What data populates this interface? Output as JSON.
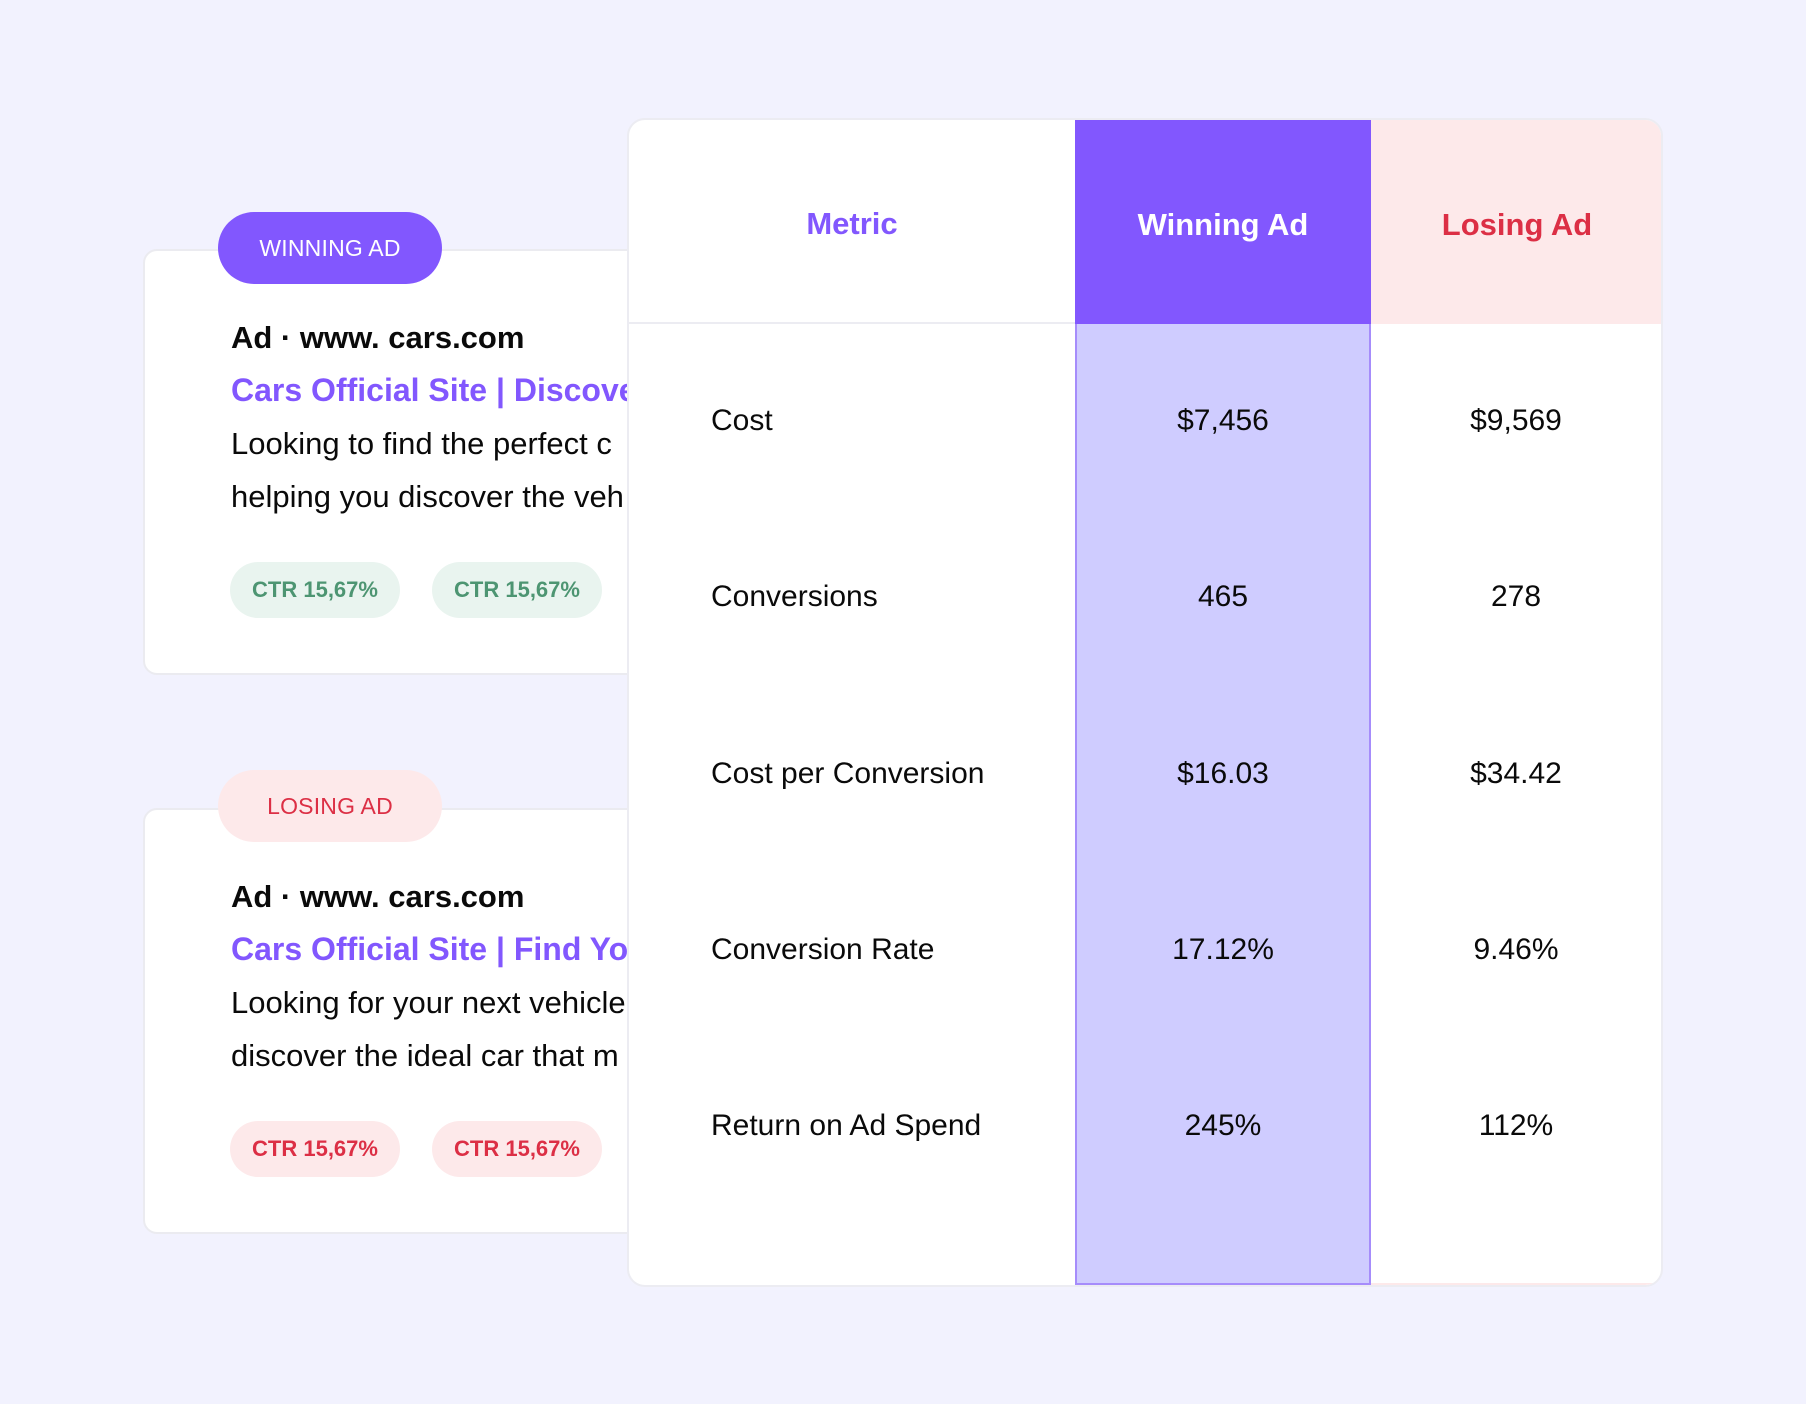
{
  "winning_ad": {
    "badge": "WINNING AD",
    "url_line": "Ad · www. cars.com",
    "title": "Cars Official Site | Discover",
    "description_lines": [
      "Looking to find the perfect c",
      "helping you discover the veh"
    ],
    "chips": [
      "CTR 15,67%",
      "CTR 15,67%"
    ],
    "accent_color": "#8257fe",
    "chip_color": "#4d9572"
  },
  "losing_ad": {
    "badge": "LOSING AD",
    "url_line": "Ad · www. cars.com",
    "title": "Cars Official Site | Find Your",
    "description_lines": [
      "Looking for your next vehicle",
      "discover the ideal car that m"
    ],
    "chips": [
      "CTR 15,67%",
      "CTR 15,67%"
    ],
    "accent_color": "#dc2f45",
    "chip_color": "#dc2f45"
  },
  "comparison_table": {
    "headers": {
      "metric": "Metric",
      "winning": "Winning Ad",
      "losing": "Losing Ad"
    },
    "rows": [
      {
        "metric": "Cost",
        "winning": "$7,456",
        "losing": "$9,569"
      },
      {
        "metric": "Conversions",
        "winning": "465",
        "losing": "278"
      },
      {
        "metric": "Cost per Conversion",
        "winning": "$16.03",
        "losing": "$34.42"
      },
      {
        "metric": "Conversion Rate",
        "winning": "17.12%",
        "losing": "9.46%"
      },
      {
        "metric": "Return on Ad Spend",
        "winning": "245%",
        "losing": "112%"
      }
    ],
    "colors": {
      "winning_header": "#8257fe",
      "winning_fill": "#cfccff",
      "losing_header": "#fde9ea",
      "losing_text": "#dc2f45"
    }
  }
}
